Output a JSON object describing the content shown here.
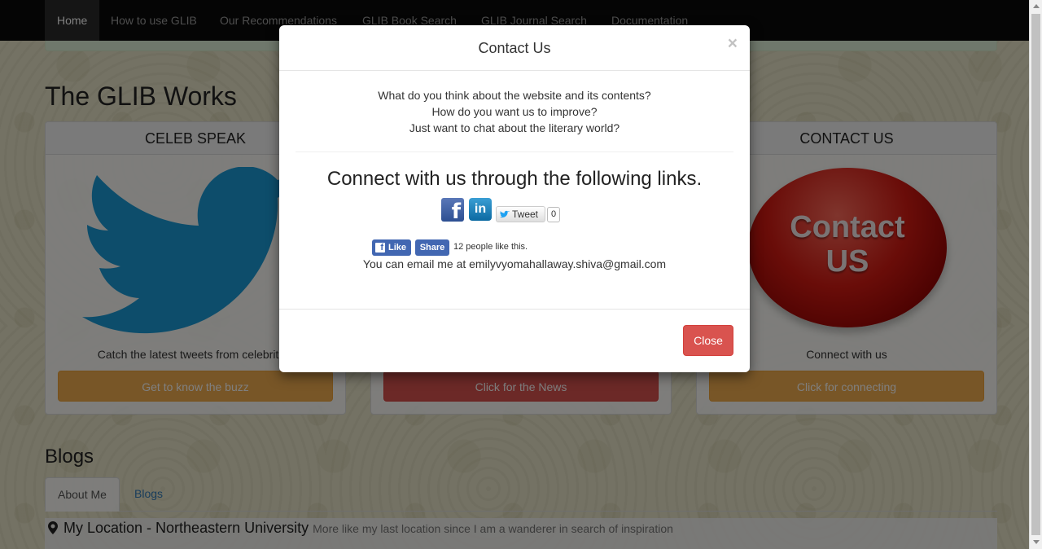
{
  "nav": {
    "items": [
      {
        "label": "Home"
      },
      {
        "label": "How to use GLIB"
      },
      {
        "label": "Our Recommendations"
      },
      {
        "label": "GLIB Book Search"
      },
      {
        "label": "GLIB Journal Search"
      },
      {
        "label": "Documentation"
      }
    ]
  },
  "main": {
    "heading": "The GLIB Works",
    "panels": [
      {
        "title": "CELEB SPEAK",
        "text": "Catch the latest tweets from celebrities",
        "button": "Get to know the buzz"
      },
      {
        "title": "",
        "text": "",
        "button": "Click for the News"
      },
      {
        "title": "CONTACT US",
        "text": "Connect with us",
        "button": "Click for connecting",
        "image_text": [
          "Contact",
          "US"
        ]
      }
    ]
  },
  "blogs": {
    "heading": "Blogs",
    "tabs": [
      {
        "label": "About Me"
      },
      {
        "label": "Blogs"
      }
    ],
    "location_title": "My Location - Northeastern University",
    "location_sub": "More like my last location since I am a wanderer in search of inspiration"
  },
  "modal": {
    "title": "Contact Us",
    "close_symbol": "×",
    "questions": [
      "What do you think about the website and its contents?",
      "How do you want us to improve?",
      "Just want to chat about the literary world?"
    ],
    "connect_heading": "Connect with us through the following links.",
    "linkedin_label": "in",
    "facebook_label": "f",
    "tweet_label": "Tweet",
    "tweet_count": "0",
    "like_label": "Like",
    "share_label": "Share",
    "like_count_text": "12 people like this.",
    "email_text": "You can email me at emilyvyomahallaway.shiva@gmail.com",
    "close_button": "Close"
  },
  "colors": {
    "navbar": "#0a0a0a",
    "warning": "#f0ad4e",
    "danger": "#d9534f",
    "facebook": "#4267b2",
    "twitter": "#1da1f2",
    "link": "#337ab7"
  },
  "icons": [
    "twitter-bird-icon",
    "facebook-icon",
    "linkedin-icon",
    "map-marker-icon",
    "close-icon"
  ]
}
